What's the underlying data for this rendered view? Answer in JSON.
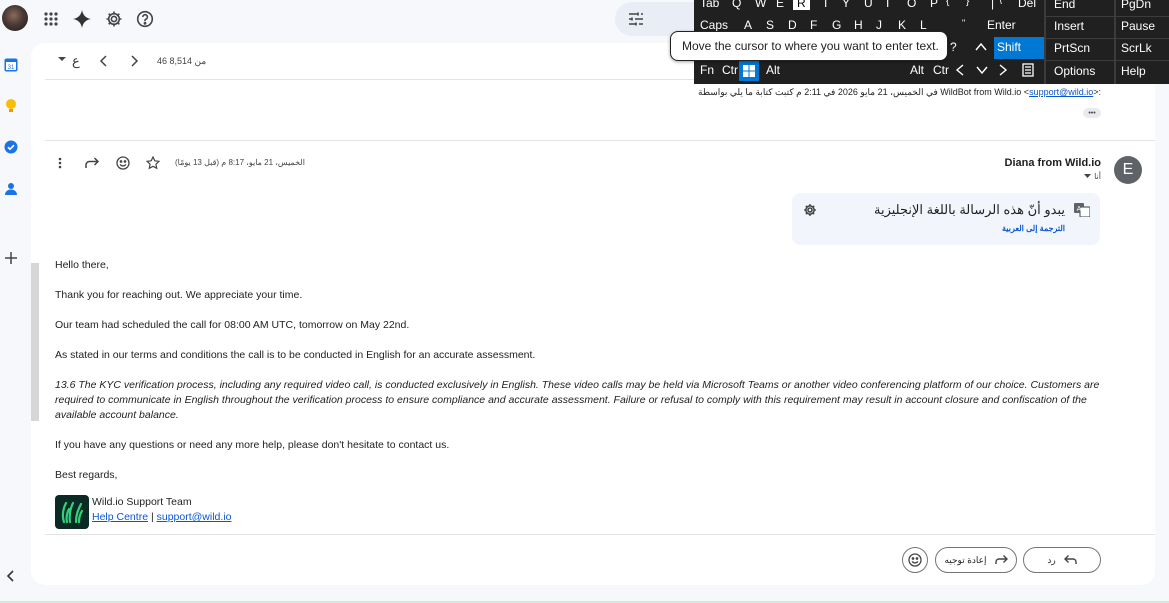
{
  "toolbar": {
    "count": "46 من 8,514",
    "keyboard_label": "ع"
  },
  "tooltip": {
    "text": "Move the cursor to where you want to enter text."
  },
  "keyboard": {
    "row1": [
      "Tab",
      "Q",
      "W",
      "E",
      "R",
      "T",
      "Y",
      "U",
      "I",
      "O",
      "P",
      "{",
      "}",
      "|",
      "\\",
      "Del"
    ],
    "row2": [
      "Caps",
      "A",
      "S",
      "D",
      "F",
      "G",
      "H",
      "J",
      "K",
      "L",
      ":",
      ";",
      "\"",
      "'",
      "Enter"
    ],
    "row3": [
      "?",
      "Shift"
    ],
    "row4": [
      "Fn",
      "Ctrl",
      "Alt",
      "Alt",
      "Ctrl"
    ],
    "right_col1": [
      "End",
      "Insert",
      "PrtScn",
      "Options"
    ],
    "right_col2": [
      "PgDn",
      "Pause",
      "ScrLk",
      "Help"
    ]
  },
  "previous_message": {
    "text": "في الخميس، 21 مايو 2026 في 2:11 م كتبت كتابة ما يلي بواسطة WildBot from Wild.io <",
    "email": "support@wild.io",
    "suffix": ">:",
    "ellipsis": "•••"
  },
  "message": {
    "sender_name": "Diana from Wild.io",
    "sender_initial": "E",
    "to_label": "أنا",
    "date": "الخميس، 21 مايو، 8:17 م (قبل 13 يومًا)",
    "translate_title": "يبدو أنّ هذه الرسالة باللغة الإنجليزية",
    "translate_link": "الترجمة إلى العربية",
    "greeting": "Hello there,",
    "p1": "Thank you for reaching out. We appreciate your time.",
    "p2": "Our team had scheduled the call for 08:00 AM UTC, tomorrow on May 22nd.",
    "p3": "As stated in our terms and conditions the call is to be conducted in English for an accurate assessment.",
    "quote_line1": "13.6 The KYC verification process, including any required video call, is conducted exclusively in English. These video calls may be held via Microsoft Teams or another video conferencing platform of our choice. Customers are",
    "quote_line2": "required to communicate in English throughout the verification process to ensure compliance and accurate assessment. Failure or refusal to comply with this requirement may result in account closure and confiscation of the",
    "quote_line3": "available account balance.",
    "p4": "If you have any questions or need any more help, please don't hesitate to contact us.",
    "closing": "Best regards,",
    "sig_team": "Wild.io Support Team",
    "sig_help": "Help Centre",
    "sig_sep": "|",
    "sig_email": "support@wild.io"
  },
  "actions": {
    "reply": "رد",
    "forward": "إعادة توجيه"
  }
}
